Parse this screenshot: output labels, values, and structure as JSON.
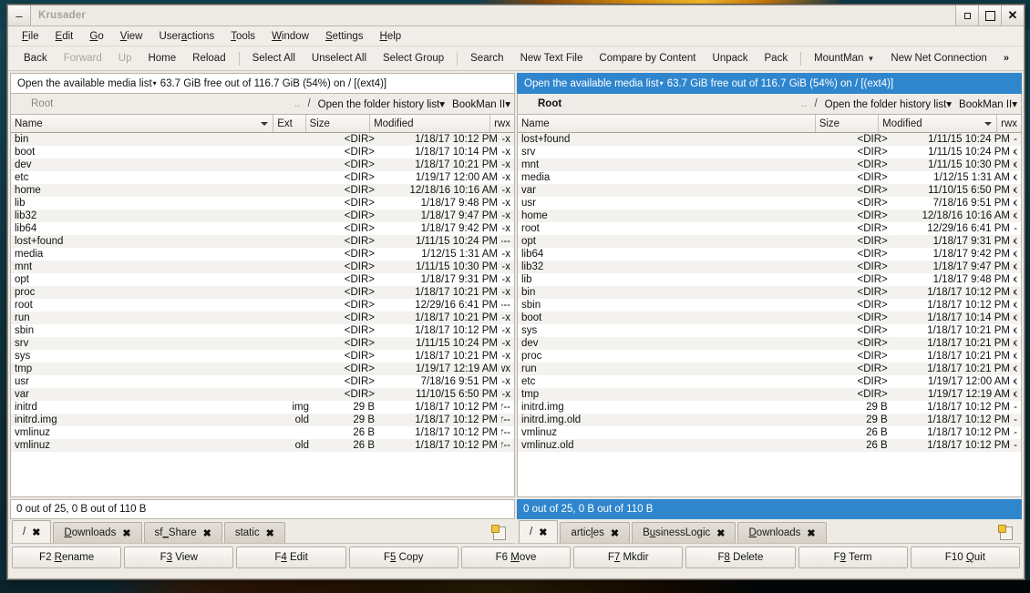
{
  "window": {
    "title": "Krusader",
    "minimize_label": "–",
    "restore_label": "▫",
    "maximize_label": "□",
    "close_label": "✕"
  },
  "menubar": [
    {
      "label": "File",
      "accel": "F"
    },
    {
      "label": "Edit",
      "accel": "E"
    },
    {
      "label": "Go",
      "accel": "G"
    },
    {
      "label": "View",
      "accel": "V"
    },
    {
      "label": "Useractions",
      "accel": "a"
    },
    {
      "label": "Tools",
      "accel": "T"
    },
    {
      "label": "Window",
      "accel": "W"
    },
    {
      "label": "Settings",
      "accel": "S"
    },
    {
      "label": "Help",
      "accel": "H"
    }
  ],
  "toolbar": {
    "items": [
      {
        "label": "Back",
        "disabled": false,
        "type": "button"
      },
      {
        "label": "Forward",
        "disabled": true,
        "type": "button"
      },
      {
        "label": "Up",
        "disabled": true,
        "type": "button"
      },
      {
        "label": "Home",
        "disabled": false,
        "type": "button"
      },
      {
        "label": "Reload",
        "disabled": false,
        "type": "button"
      },
      {
        "label": "",
        "type": "separator"
      },
      {
        "label": "Select All",
        "disabled": false,
        "type": "button"
      },
      {
        "label": "Unselect All",
        "disabled": false,
        "type": "button"
      },
      {
        "label": "Select Group",
        "disabled": false,
        "type": "button"
      },
      {
        "label": "",
        "type": "separator"
      },
      {
        "label": "Search",
        "disabled": false,
        "type": "button"
      },
      {
        "label": "New Text File",
        "disabled": false,
        "type": "button"
      },
      {
        "label": "Compare by Content",
        "disabled": false,
        "type": "button"
      },
      {
        "label": "Unpack",
        "disabled": false,
        "type": "button"
      },
      {
        "label": "Pack",
        "disabled": false,
        "type": "button"
      },
      {
        "label": "",
        "type": "separator"
      },
      {
        "label": "MountMan",
        "disabled": false,
        "type": "dropdown"
      },
      {
        "label": "New Net Connection",
        "disabled": false,
        "type": "button"
      }
    ],
    "overflow_label": "»"
  },
  "left_panel": {
    "active": false,
    "media_prefix": "Open the available media list",
    "media_info": "63.7 GiB free out of 116.7 GiB (54%) on / [(ext4)]",
    "root_label": "Root",
    "dots_label": "..",
    "slash_label": "/",
    "history_label": "Open the folder history list",
    "bookman_label": "BookMan II",
    "columns": [
      "Name",
      "Ext",
      "Size",
      "Modified",
      "rwx"
    ],
    "sort_column": "Name",
    "totals": "0 out of 25, 0 B out of 110 B",
    "rows": [
      {
        "name": "bin",
        "ext": "",
        "size": "<DIR>",
        "modified": "1/18/17 10:12 PM",
        "rwx": "r-x"
      },
      {
        "name": "boot",
        "ext": "",
        "size": "<DIR>",
        "modified": "1/18/17 10:14 PM",
        "rwx": "r-x"
      },
      {
        "name": "dev",
        "ext": "",
        "size": "<DIR>",
        "modified": "1/18/17 10:21 PM",
        "rwx": "r-x"
      },
      {
        "name": "etc",
        "ext": "",
        "size": "<DIR>",
        "modified": "1/19/17 12:00 AM",
        "rwx": "r-x"
      },
      {
        "name": "home",
        "ext": "",
        "size": "<DIR>",
        "modified": "12/18/16 10:16 AM",
        "rwx": "r-x"
      },
      {
        "name": "lib",
        "ext": "",
        "size": "<DIR>",
        "modified": "1/18/17 9:48 PM",
        "rwx": "r-x"
      },
      {
        "name": "lib32",
        "ext": "",
        "size": "<DIR>",
        "modified": "1/18/17 9:47 PM",
        "rwx": "r-x"
      },
      {
        "name": "lib64",
        "ext": "",
        "size": "<DIR>",
        "modified": "1/18/17 9:42 PM",
        "rwx": "r-x"
      },
      {
        "name": "lost+found",
        "ext": "",
        "size": "<DIR>",
        "modified": "1/11/15 10:24 PM",
        "rwx": "---"
      },
      {
        "name": "media",
        "ext": "",
        "size": "<DIR>",
        "modified": "1/12/15 1:31 AM",
        "rwx": "r-x"
      },
      {
        "name": "mnt",
        "ext": "",
        "size": "<DIR>",
        "modified": "1/11/15 10:30 PM",
        "rwx": "r-x"
      },
      {
        "name": "opt",
        "ext": "",
        "size": "<DIR>",
        "modified": "1/18/17 9:31 PM",
        "rwx": "r-x"
      },
      {
        "name": "proc",
        "ext": "",
        "size": "<DIR>",
        "modified": "1/18/17 10:21 PM",
        "rwx": "r-x"
      },
      {
        "name": "root",
        "ext": "",
        "size": "<DIR>",
        "modified": "12/29/16 6:41 PM",
        "rwx": "---"
      },
      {
        "name": "run",
        "ext": "",
        "size": "<DIR>",
        "modified": "1/18/17 10:21 PM",
        "rwx": "r-x"
      },
      {
        "name": "sbin",
        "ext": "",
        "size": "<DIR>",
        "modified": "1/18/17 10:12 PM",
        "rwx": "r-x"
      },
      {
        "name": "srv",
        "ext": "",
        "size": "<DIR>",
        "modified": "1/11/15 10:24 PM",
        "rwx": "r-x"
      },
      {
        "name": "sys",
        "ext": "",
        "size": "<DIR>",
        "modified": "1/18/17 10:21 PM",
        "rwx": "r-x"
      },
      {
        "name": "tmp",
        "ext": "",
        "size": "<DIR>",
        "modified": "1/19/17 12:19 AM",
        "rwx": "rwx"
      },
      {
        "name": "usr",
        "ext": "",
        "size": "<DIR>",
        "modified": "7/18/16 9:51 PM",
        "rwx": "r-x"
      },
      {
        "name": "var",
        "ext": "",
        "size": "<DIR>",
        "modified": "11/10/15 6:50 PM",
        "rwx": "r-x"
      },
      {
        "name": "initrd",
        "ext": "img",
        "size": "29 B",
        "modified": "1/18/17 10:12 PM",
        "rwx": "r--"
      },
      {
        "name": "initrd.img",
        "ext": "old",
        "size": "29 B",
        "modified": "1/18/17 10:12 PM",
        "rwx": "r--"
      },
      {
        "name": "vmlinuz",
        "ext": "",
        "size": "26 B",
        "modified": "1/18/17 10:12 PM",
        "rwx": "r--"
      },
      {
        "name": "vmlinuz",
        "ext": "old",
        "size": "26 B",
        "modified": "1/18/17 10:12 PM",
        "rwx": "r--"
      }
    ],
    "tabs": [
      {
        "label": "/",
        "selected": true
      },
      {
        "label": "Downloads",
        "selected": false,
        "accel": "D"
      },
      {
        "label": "sf_Share",
        "selected": false,
        "accel": "_"
      },
      {
        "label": "static",
        "selected": false
      }
    ],
    "close_glyph": "✖"
  },
  "right_panel": {
    "active": true,
    "media_prefix": "Open the available media list",
    "media_info": "63.7 GiB free out of 116.7 GiB (54%) on / [(ext4)]",
    "root_label": "Root",
    "dots_label": "..",
    "slash_label": "/",
    "history_label": "Open the folder history list",
    "bookman_label": "BookMan II",
    "columns": [
      "Name",
      "Size",
      "Modified",
      "rwx"
    ],
    "sort_column": "Modified",
    "totals": "0 out of 25, 0 B out of 110 B",
    "rows": [
      {
        "name": "lost+found",
        "size": "<DIR>",
        "modified": "1/11/15 10:24 PM",
        "rwx": "---"
      },
      {
        "name": "srv",
        "size": "<DIR>",
        "modified": "1/11/15 10:24 PM",
        "rwx": "r-x"
      },
      {
        "name": "mnt",
        "size": "<DIR>",
        "modified": "1/11/15 10:30 PM",
        "rwx": "r-x"
      },
      {
        "name": "media",
        "size": "<DIR>",
        "modified": "1/12/15 1:31 AM",
        "rwx": "r-x"
      },
      {
        "name": "var",
        "size": "<DIR>",
        "modified": "11/10/15 6:50 PM",
        "rwx": "r-x"
      },
      {
        "name": "usr",
        "size": "<DIR>",
        "modified": "7/18/16 9:51 PM",
        "rwx": "r-x"
      },
      {
        "name": "home",
        "size": "<DIR>",
        "modified": "12/18/16 10:16 AM",
        "rwx": "r-x"
      },
      {
        "name": "root",
        "size": "<DIR>",
        "modified": "12/29/16 6:41 PM",
        "rwx": "---"
      },
      {
        "name": "opt",
        "size": "<DIR>",
        "modified": "1/18/17 9:31 PM",
        "rwx": "r-x"
      },
      {
        "name": "lib64",
        "size": "<DIR>",
        "modified": "1/18/17 9:42 PM",
        "rwx": "r-x"
      },
      {
        "name": "lib32",
        "size": "<DIR>",
        "modified": "1/18/17 9:47 PM",
        "rwx": "r-x"
      },
      {
        "name": "lib",
        "size": "<DIR>",
        "modified": "1/18/17 9:48 PM",
        "rwx": "r-x"
      },
      {
        "name": "bin",
        "size": "<DIR>",
        "modified": "1/18/17 10:12 PM",
        "rwx": "r-x"
      },
      {
        "name": "sbin",
        "size": "<DIR>",
        "modified": "1/18/17 10:12 PM",
        "rwx": "r-x"
      },
      {
        "name": "boot",
        "size": "<DIR>",
        "modified": "1/18/17 10:14 PM",
        "rwx": "r-x"
      },
      {
        "name": "sys",
        "size": "<DIR>",
        "modified": "1/18/17 10:21 PM",
        "rwx": "r-x"
      },
      {
        "name": "dev",
        "size": "<DIR>",
        "modified": "1/18/17 10:21 PM",
        "rwx": "r-x"
      },
      {
        "name": "proc",
        "size": "<DIR>",
        "modified": "1/18/17 10:21 PM",
        "rwx": "r-x"
      },
      {
        "name": "run",
        "size": "<DIR>",
        "modified": "1/18/17 10:21 PM",
        "rwx": "r-x"
      },
      {
        "name": "etc",
        "size": "<DIR>",
        "modified": "1/19/17 12:00 AM",
        "rwx": "r-x"
      },
      {
        "name": "tmp",
        "size": "<DIR>",
        "modified": "1/19/17 12:19 AM",
        "rwx": "rwx"
      },
      {
        "name": "initrd.img",
        "size": "29 B",
        "modified": "1/18/17 10:12 PM",
        "rwx": "r--"
      },
      {
        "name": "initrd.img.old",
        "size": "29 B",
        "modified": "1/18/17 10:12 PM",
        "rwx": "r--"
      },
      {
        "name": "vmlinuz",
        "size": "26 B",
        "modified": "1/18/17 10:12 PM",
        "rwx": "r--"
      },
      {
        "name": "vmlinuz.old",
        "size": "26 B",
        "modified": "1/18/17 10:12 PM",
        "rwx": "r--"
      }
    ],
    "tabs": [
      {
        "label": "/",
        "selected": true
      },
      {
        "label": "articles",
        "selected": false,
        "accel": "l"
      },
      {
        "label": "BusinessLogic",
        "selected": false,
        "accel": "u"
      },
      {
        "label": "Downloads",
        "selected": false,
        "accel": "D"
      }
    ],
    "close_glyph": "✖"
  },
  "function_keys": [
    {
      "key": "F2",
      "label": "Rename",
      "accel": "R"
    },
    {
      "key": "F3",
      "label": "View",
      "accel": "3"
    },
    {
      "key": "F4",
      "label": "Edit",
      "accel": "4"
    },
    {
      "key": "F5",
      "label": "Copy",
      "accel": "5"
    },
    {
      "key": "F6",
      "label": "Move",
      "accel": "M"
    },
    {
      "key": "F7",
      "label": "Mkdir",
      "accel": "7"
    },
    {
      "key": "F8",
      "label": "Delete",
      "accel": "8"
    },
    {
      "key": "F9",
      "label": "Term",
      "accel": "9"
    },
    {
      "key": "F10",
      "label": "Quit",
      "accel": "Q"
    }
  ],
  "colors": {
    "active_panel": "#2f86cd",
    "window_bg": "#eeeae4",
    "row_alt": "#f4f2ef",
    "desktop": "#0d3a45"
  }
}
